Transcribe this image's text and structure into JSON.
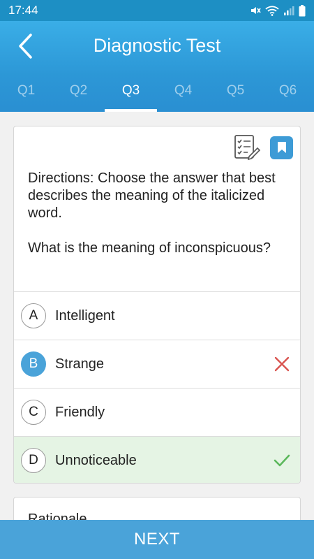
{
  "status_bar": {
    "time": "17:44"
  },
  "header": {
    "title": "Diagnostic Test"
  },
  "tabs": [
    {
      "label": "Q1"
    },
    {
      "label": "Q2"
    },
    {
      "label": "Q3"
    },
    {
      "label": "Q4"
    },
    {
      "label": "Q5"
    },
    {
      "label": "Q6"
    }
  ],
  "active_tab": "Q3",
  "question": {
    "directions": "Directions: Choose the answer that best describes the meaning of the italicized word.",
    "prompt": "What is the meaning of inconspicuous?",
    "options": [
      {
        "letter": "A",
        "text": "Intelligent"
      },
      {
        "letter": "B",
        "text": "Strange"
      },
      {
        "letter": "C",
        "text": "Friendly"
      },
      {
        "letter": "D",
        "text": "Unnoticeable"
      }
    ],
    "selected": "B",
    "correct": "D"
  },
  "rationale": {
    "title": "Rationale"
  },
  "footer": {
    "next_label": "NEXT"
  },
  "colors": {
    "header": "#2c97d6",
    "accent": "#4aa3d9",
    "correct_bg": "#e5f4e4",
    "correct_mark": "#5cb85c",
    "wrong_mark": "#d9534f"
  },
  "icons": [
    "back-arrow-icon",
    "checklist-icon",
    "bookmark-icon",
    "wrong-x-icon",
    "correct-check-icon",
    "mute-icon",
    "wifi-icon",
    "signal-icon",
    "battery-icon"
  ]
}
